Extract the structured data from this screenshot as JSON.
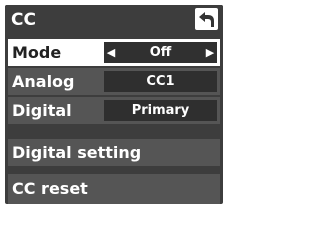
{
  "header": {
    "title": "CC",
    "back_icon": "return-arrow-icon"
  },
  "menu": {
    "mode": {
      "label": "Mode",
      "value": "Off"
    },
    "analog": {
      "label": "Analog",
      "value": "CC1"
    },
    "digital": {
      "label": "Digital",
      "value": "Primary"
    },
    "digital_setting": {
      "label": "Digital setting"
    },
    "cc_reset": {
      "label": "CC reset"
    }
  },
  "colors": {
    "panel_bg": "#3d3d3d",
    "row_bg": "#555555",
    "selected_row_bg": "#ffffff",
    "text": "#ffffff"
  }
}
